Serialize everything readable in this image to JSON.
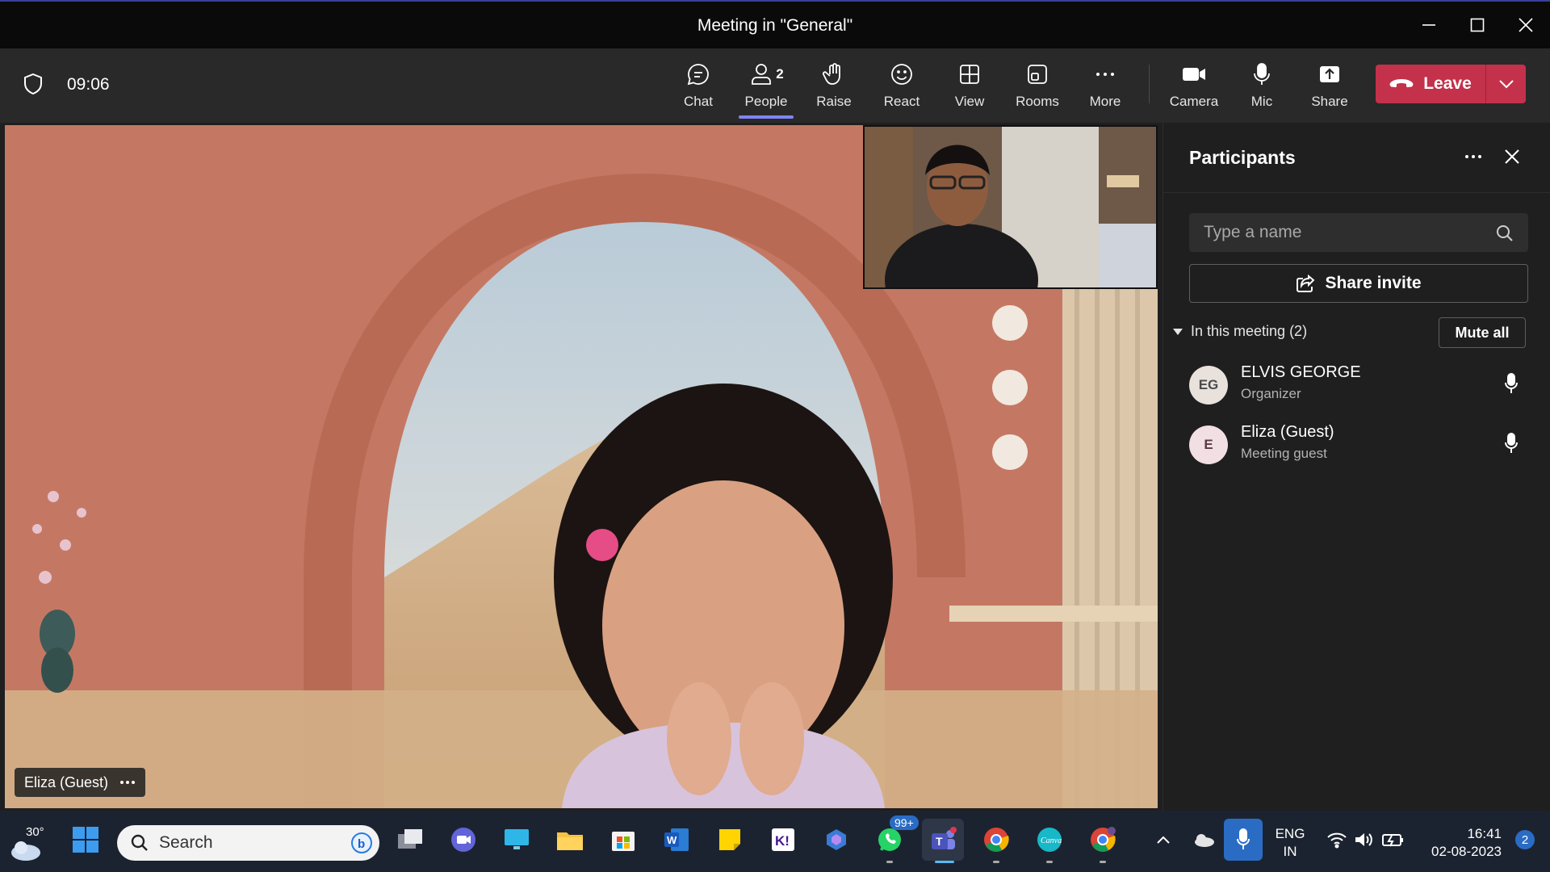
{
  "window": {
    "title": "Meeting in \"General\""
  },
  "toolbar": {
    "timer": "09:06",
    "items": [
      {
        "label": "Chat",
        "icon": "chat-icon"
      },
      {
        "label": "People",
        "icon": "people-icon",
        "count": "2"
      },
      {
        "label": "Raise",
        "icon": "hand-icon"
      },
      {
        "label": "React",
        "icon": "smile-icon"
      },
      {
        "label": "View",
        "icon": "grid-icon"
      },
      {
        "label": "Rooms",
        "icon": "rooms-icon"
      },
      {
        "label": "More",
        "icon": "more-icon"
      },
      {
        "label": "Camera",
        "icon": "camera-icon"
      },
      {
        "label": "Mic",
        "icon": "mic-icon"
      },
      {
        "label": "Share",
        "icon": "share-icon"
      }
    ],
    "leave_label": "Leave",
    "leave_color": "#c4314b"
  },
  "stage": {
    "speaker_name": "Eliza (Guest)"
  },
  "participants": {
    "title": "Participants",
    "search_placeholder": "Type a name",
    "share_invite_label": "Share invite",
    "section_label": "In this meeting (2)",
    "mute_all_label": "Mute all",
    "people": [
      {
        "initials": "EG",
        "name": "ELVIS GEORGE",
        "role": "Organizer",
        "avatar_bg": "#e8e1dc",
        "avatar_fg": "#4b4b4b"
      },
      {
        "initials": "E",
        "name": "Eliza (Guest)",
        "role": "Meeting guest",
        "avatar_bg": "#f1dfe4",
        "avatar_fg": "#5a3b45"
      }
    ]
  },
  "taskbar": {
    "weather_temp": "30°",
    "search_label": "Search",
    "whatsapp_badge": "99+",
    "language": "ENG",
    "region": "IN",
    "time": "16:41",
    "date": "02-08-2023",
    "notification_count": "2"
  }
}
